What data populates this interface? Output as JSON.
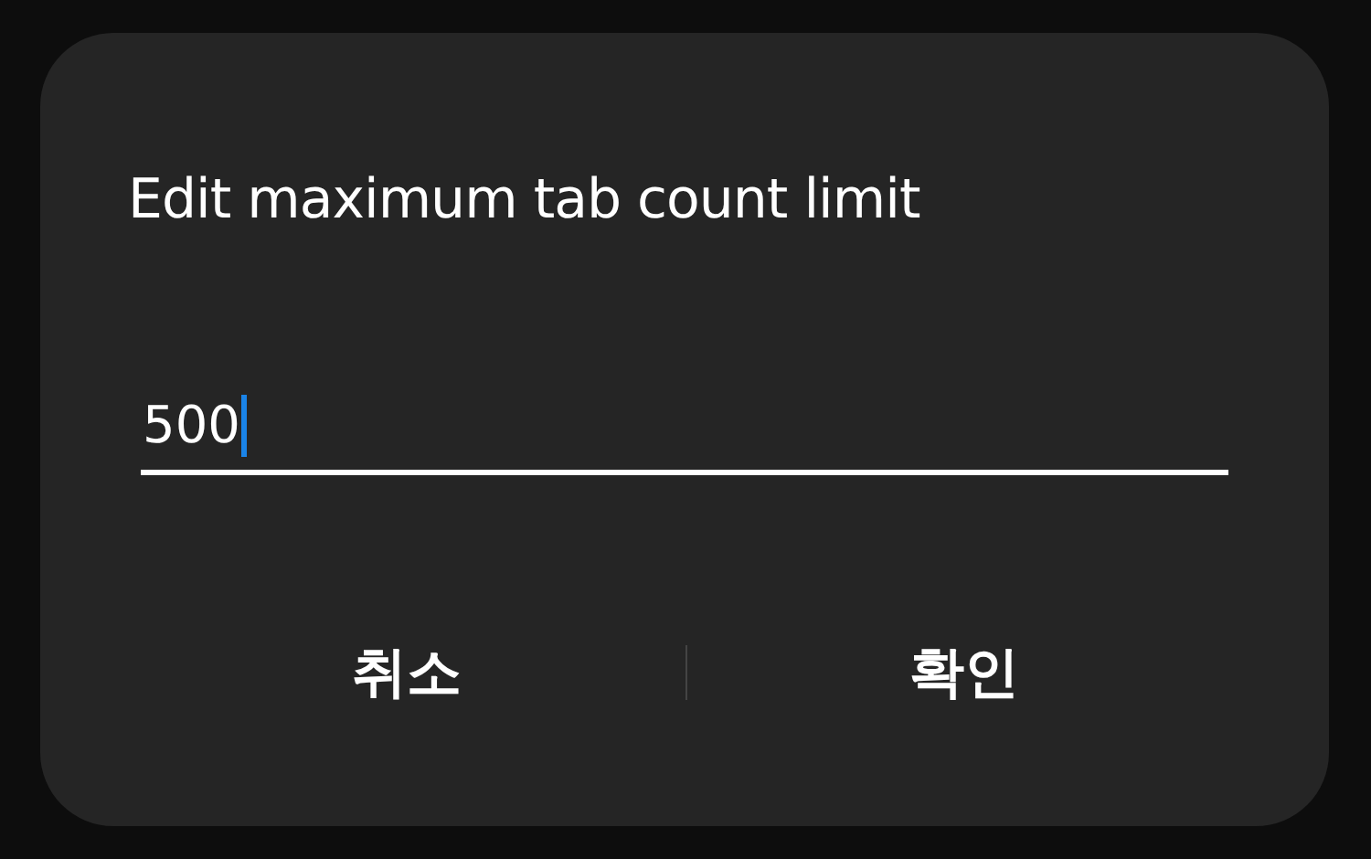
{
  "dialog": {
    "title": "Edit maximum tab count limit",
    "field": {
      "value": "500",
      "focused": true
    },
    "buttons": [
      {
        "label": "취소"
      },
      {
        "label": "확인"
      }
    ]
  }
}
